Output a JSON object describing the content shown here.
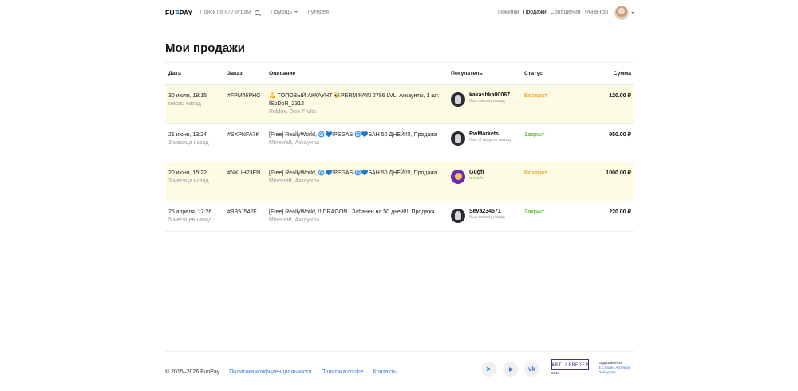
{
  "header": {
    "logo_left": "FU",
    "logo_right": "PAY",
    "search_placeholder": "Поиск по 877 играм",
    "nav_left": [
      "Помощь",
      "Лутерея"
    ],
    "nav_right": [
      "Покупки",
      "Продажи",
      "Сообщения",
      "Финансы"
    ],
    "active_nav": "Продажи"
  },
  "page_title": "Мои продажи",
  "table": {
    "columns": [
      "Дата",
      "Заказ",
      "Описание",
      "Покупатель",
      "Статус",
      "Сумма"
    ],
    "rows": [
      {
        "date": "30 июля, 18:15",
        "ago": "месяц назад",
        "order": "#FPM46PHG",
        "desc": "💪 ТОПОВЫЙ АККАУНТ 🐝PERM PAIN 2796 LVL, Аккаунты, 1 шт., fEoDoR_2312",
        "category": "Roblox, Blox Fruits",
        "buyer": "kakashka00067",
        "buyer_sub": "был месяц назад",
        "status": "Возврат",
        "sum": "120.00 ₽"
      },
      {
        "date": "21 июня, 13:24",
        "ago": "3 месяца назад",
        "order": "#SXPNFA7K",
        "desc": "[Free] ReallyWorld, 🌀💙!PEGAS!🌀💙БАН 50 ДНЕЙ!!!!, Продажа",
        "category": "Minecraft, Аккаунты",
        "buyer": "RwMarkets",
        "buyer_sub": "был 3 недели назад",
        "status": "Закрыт",
        "sum": "950.00 ₽"
      },
      {
        "date": "20 июня, 15:22",
        "ago": "3 месяца назад",
        "order": "#NKUH23EN",
        "desc": "[Free] ReallyWorld, 🌀💙!PEGAS!🌀💙БАН 50 ДНЕЙ!!!!, Продажа",
        "category": "Minecraft, Аккаунты",
        "buyer": "Gugfr",
        "buyer_sub": "онлайн",
        "status": "Возврат",
        "sum": "1000.00 ₽"
      },
      {
        "date": "26 апреля, 17:26",
        "ago": "5 месяцев назад",
        "order": "#BB5J542F",
        "desc": "[Free] ReallyWorld, !!!DRAGON , Забанен на 50 дней!!!, Продажа",
        "category": "Minecraft, Аккаунты",
        "buyer": "Seva234571",
        "buyer_sub": "был месяц назад",
        "status": "Закрыт",
        "sum": "220.00 ₽"
      }
    ]
  },
  "footer": {
    "copyright": "© 2015–2026 FunPay",
    "links": [
      "Политика конфиденциальности",
      "Политика cookie",
      "Контакты"
    ],
    "socials": [
      "telegram-icon",
      "youtube-icon",
      "vk-icon"
    ],
    "studio_logo": "ART.LEBEDEV",
    "studio_year": "2019",
    "studio_line1": "Задизайнено",
    "studio_line2_prefix": "в",
    "studio_line2_link": "Студии Артемия",
    "studio_line3_link": "Лебедева"
  },
  "colors": {
    "accent": "#3a7bd5",
    "return_status": "#f0a32a",
    "closed_status": "#67b938",
    "warn_row_bg": "#fdfbe4"
  }
}
